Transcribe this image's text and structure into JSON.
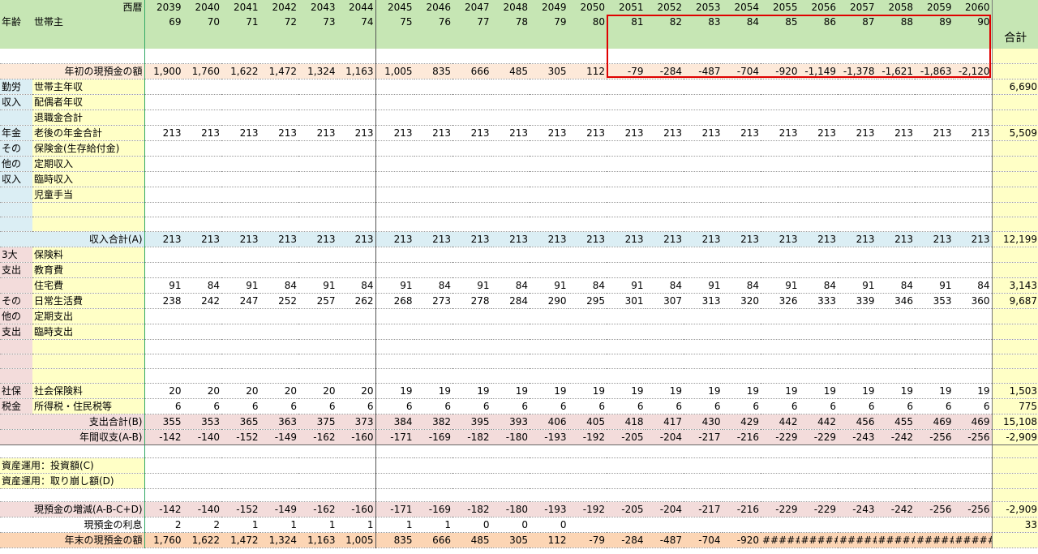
{
  "header": {
    "year_label": "西暦",
    "age_label": "年齢",
    "head_label": "世帯主",
    "total_label": "合計"
  },
  "years": [
    "2039",
    "2040",
    "2041",
    "2042",
    "2043",
    "2044",
    "2045",
    "2046",
    "2047",
    "2048",
    "2049",
    "2050",
    "2051",
    "2052",
    "2053",
    "2054",
    "2055",
    "2056",
    "2057",
    "2058",
    "2059",
    "2060"
  ],
  "ages": [
    "69",
    "70",
    "71",
    "72",
    "73",
    "74",
    "75",
    "76",
    "77",
    "78",
    "79",
    "80",
    "81",
    "82",
    "83",
    "84",
    "85",
    "86",
    "87",
    "88",
    "89",
    "90"
  ],
  "rows": {
    "cash_start": {
      "label": "年初の現預金の額",
      "values": [
        "1,900",
        "1,760",
        "1,622",
        "1,472",
        "1,324",
        "1,163",
        "1,005",
        "835",
        "666",
        "485",
        "305",
        "112",
        "-79",
        "-284",
        "-487",
        "-704",
        "-920",
        "-1,149",
        "-1,378",
        "-1,621",
        "-1,863",
        "-2,120"
      ],
      "total": ""
    },
    "work_head": {
      "cat": "勤労",
      "label": "世帯主年収",
      "values": [],
      "total": "6,690"
    },
    "work_spouse": {
      "cat": "収入",
      "label": "配偶者年収",
      "values": [],
      "total": ""
    },
    "retire": {
      "label": "退職金合計",
      "values": [],
      "total": ""
    },
    "pension": {
      "cat": "年金",
      "label": "老後の年金合計",
      "values": [
        "213",
        "213",
        "213",
        "213",
        "213",
        "213",
        "213",
        "213",
        "213",
        "213",
        "213",
        "213",
        "213",
        "213",
        "213",
        "213",
        "213",
        "213",
        "213",
        "213",
        "213",
        "213"
      ],
      "total": "5,509"
    },
    "insurance_income": {
      "cat": "その",
      "label": "保険金(生存給付金)",
      "values": [],
      "total": ""
    },
    "regular_income": {
      "cat": "他の",
      "label": "定期収入",
      "values": [],
      "total": ""
    },
    "temp_income": {
      "cat": "収入",
      "label": "臨時収入",
      "values": [],
      "total": ""
    },
    "child_allowance": {
      "label": "児童手当",
      "values": [],
      "total": ""
    },
    "income_total": {
      "label": "収入合計(A)",
      "values": [
        "213",
        "213",
        "213",
        "213",
        "213",
        "213",
        "213",
        "213",
        "213",
        "213",
        "213",
        "213",
        "213",
        "213",
        "213",
        "213",
        "213",
        "213",
        "213",
        "213",
        "213",
        "213"
      ],
      "total": "12,199"
    },
    "insurance_premium": {
      "cat": "3大",
      "label": "保険料",
      "values": [],
      "total": ""
    },
    "education": {
      "cat": "支出",
      "label": "教育費",
      "values": [],
      "total": ""
    },
    "housing": {
      "label": "住宅費",
      "values": [
        "91",
        "84",
        "91",
        "84",
        "91",
        "84",
        "91",
        "84",
        "91",
        "84",
        "91",
        "84",
        "91",
        "84",
        "91",
        "84",
        "91",
        "84",
        "91",
        "84",
        "91",
        "84"
      ],
      "total": "3,143"
    },
    "living": {
      "cat": "その",
      "label": "日常生活費",
      "values": [
        "238",
        "242",
        "247",
        "252",
        "257",
        "262",
        "268",
        "273",
        "278",
        "284",
        "290",
        "295",
        "301",
        "307",
        "313",
        "320",
        "326",
        "333",
        "339",
        "346",
        "353",
        "360"
      ],
      "total": "9,687"
    },
    "regular_exp": {
      "cat": "他の",
      "label": "定期支出",
      "values": [],
      "total": ""
    },
    "temp_exp": {
      "cat": "支出",
      "label": "臨時支出",
      "values": [],
      "total": ""
    },
    "social_ins": {
      "cat": "社保",
      "label": "社会保険料",
      "values": [
        "20",
        "20",
        "20",
        "20",
        "20",
        "20",
        "19",
        "19",
        "19",
        "19",
        "19",
        "19",
        "19",
        "19",
        "19",
        "19",
        "19",
        "19",
        "19",
        "19",
        "19",
        "19"
      ],
      "total": "1,503"
    },
    "income_tax": {
      "cat": "税金",
      "label": "所得税・住民税等",
      "values": [
        "6",
        "6",
        "6",
        "6",
        "6",
        "6",
        "6",
        "6",
        "6",
        "6",
        "6",
        "6",
        "6",
        "6",
        "6",
        "6",
        "6",
        "6",
        "6",
        "6",
        "6",
        "6"
      ],
      "total": "775"
    },
    "expense_total": {
      "label": "支出合計(B)",
      "values": [
        "355",
        "353",
        "365",
        "363",
        "375",
        "373",
        "384",
        "382",
        "395",
        "393",
        "406",
        "405",
        "418",
        "417",
        "430",
        "429",
        "442",
        "442",
        "456",
        "455",
        "469",
        "469"
      ],
      "total": "15,108"
    },
    "annual_net": {
      "label": "年間収支(A-B)",
      "values": [
        "-142",
        "-140",
        "-152",
        "-149",
        "-162",
        "-160",
        "-171",
        "-169",
        "-182",
        "-180",
        "-193",
        "-192",
        "-205",
        "-204",
        "-217",
        "-216",
        "-229",
        "-229",
        "-243",
        "-242",
        "-256",
        "-256"
      ],
      "total": "-2,909"
    },
    "invest": {
      "label": "資産運用：投資額(C)",
      "values": [],
      "total": ""
    },
    "withdraw": {
      "label": "資産運用：取り崩し額(D)",
      "values": [],
      "total": ""
    },
    "cash_change": {
      "label": "現預金の増減(A-B-C+D)",
      "values": [
        "-142",
        "-140",
        "-152",
        "-149",
        "-162",
        "-160",
        "-171",
        "-169",
        "-182",
        "-180",
        "-193",
        "-192",
        "-205",
        "-204",
        "-217",
        "-216",
        "-229",
        "-229",
        "-243",
        "-242",
        "-256",
        "-256"
      ],
      "total": "-2,909"
    },
    "cash_interest": {
      "label": "現預金の利息",
      "values": [
        "2",
        "2",
        "1",
        "1",
        "1",
        "1",
        "1",
        "1",
        "0",
        "0",
        "0",
        "",
        "",
        "",
        "",
        "",
        "",
        "",
        "",
        "",
        "",
        ""
      ],
      "total": "33"
    },
    "cash_end": {
      "label": "年末の現預金の額",
      "values": [
        "1,760",
        "1,622",
        "1,472",
        "1,324",
        "1,163",
        "1,005",
        "835",
        "666",
        "485",
        "305",
        "112",
        "-79",
        "-284",
        "-487",
        "-704",
        "-920",
        "#####",
        "#####",
        "#####",
        "#####",
        "#####",
        "#####"
      ],
      "total": ""
    }
  },
  "colors": {
    "header": "#c6e6b4",
    "cash": "#fde9d9",
    "income": "#dbeef4",
    "expense": "#f3dcdb",
    "total_col": "#ffffc6",
    "end": "#fcd5b4",
    "negative": "#ff0000",
    "highlight": "#e00000"
  }
}
